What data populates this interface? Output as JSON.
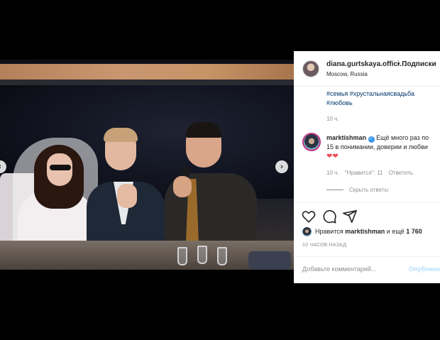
{
  "post": {
    "username": "diana.gurtskaya.offici…",
    "follow_label": "• Подписки",
    "location": "Moscow, Russia",
    "hashtags": "#семья #хрустальнаясвадьба #любовь",
    "caption_time": "10 ч."
  },
  "comment": {
    "username": "marktishman",
    "text": "Ещё много раз по 15 в понимании, доверии и любви",
    "hearts": "❤❤",
    "time": "10 ч.",
    "likes": "\"Нравится\": 11",
    "reply_label": "Ответить",
    "hide_replies_label": "Скрыть ответы"
  },
  "likes": {
    "prefix": "Нравится",
    "user": "marktishman",
    "suffix": "и ещё",
    "count": "1 760"
  },
  "time_ago": "10 ЧАСОВ НАЗАД",
  "comment_box": {
    "placeholder": "Добавьте комментарий...",
    "publish_label": "Опубликовать"
  },
  "carousel": {
    "slides": 6,
    "active_index": 0
  },
  "icons": [
    "heart-icon",
    "comment-icon",
    "share-icon",
    "verified-icon",
    "chevron-right-icon"
  ],
  "colors": {
    "link": "#00376b",
    "accent": "#3897f0",
    "heart": "#ed4956",
    "muted": "#8e8e8e"
  }
}
